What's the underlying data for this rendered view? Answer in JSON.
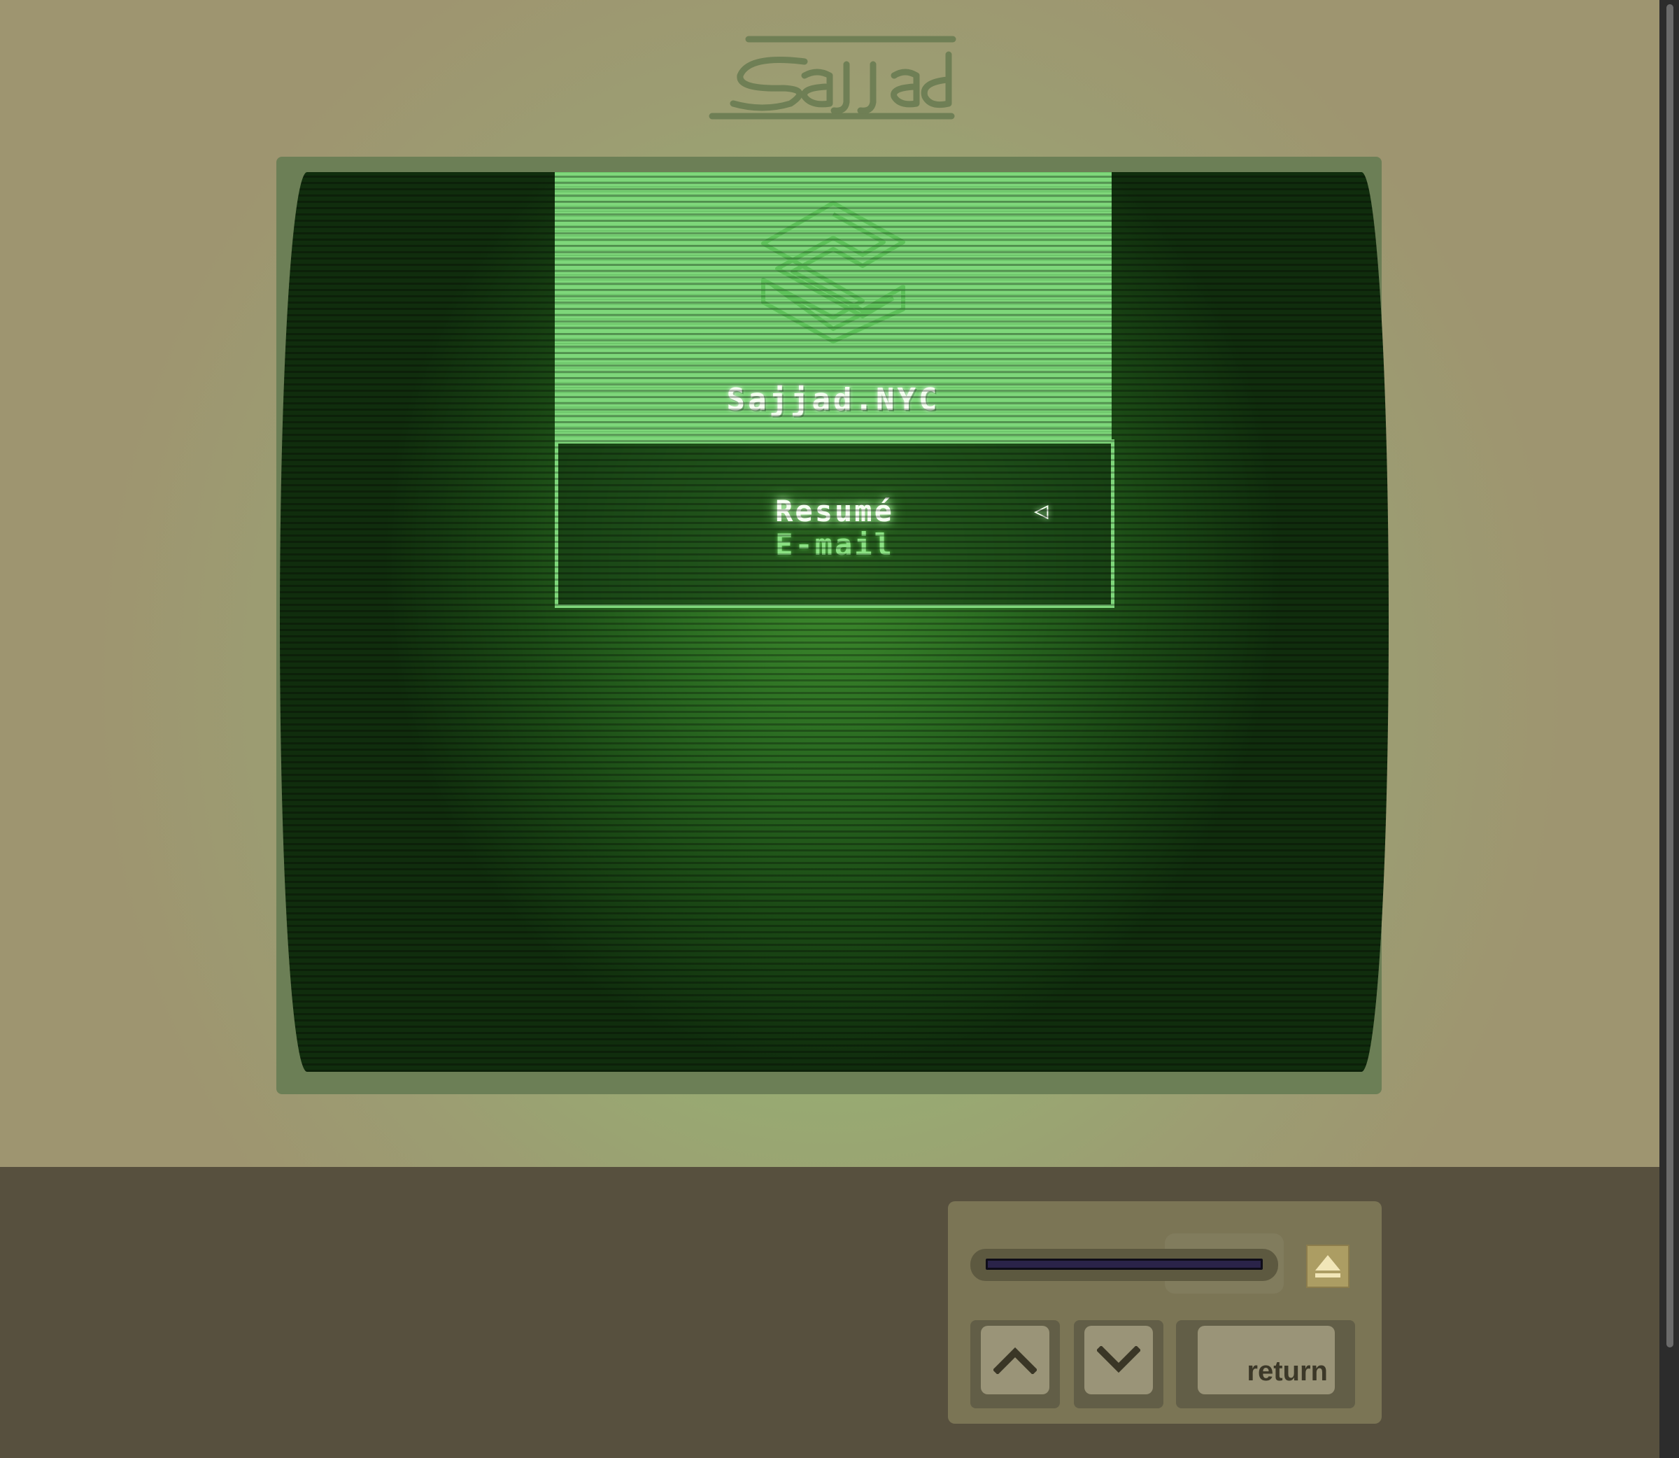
{
  "header": {
    "signature_logo_text": "Sajjad"
  },
  "screen": {
    "site_title": "Sajjad.NYC",
    "logo_icon": "s-cube-logo-icon",
    "menu": {
      "items": [
        {
          "label": "Resumé",
          "selected": true
        },
        {
          "label": "E-mail",
          "selected": false
        }
      ],
      "cursor_glyph": "◁"
    }
  },
  "controls": {
    "eject_icon": "eject-icon",
    "up_icon": "chevron-up-icon",
    "down_icon": "chevron-down-icon",
    "return_label": "return"
  },
  "colors": {
    "screen_green": "#2a6b21",
    "panel_green": "#7ed77a",
    "text_glow": "#f6fff2",
    "desk": "#57503e"
  }
}
